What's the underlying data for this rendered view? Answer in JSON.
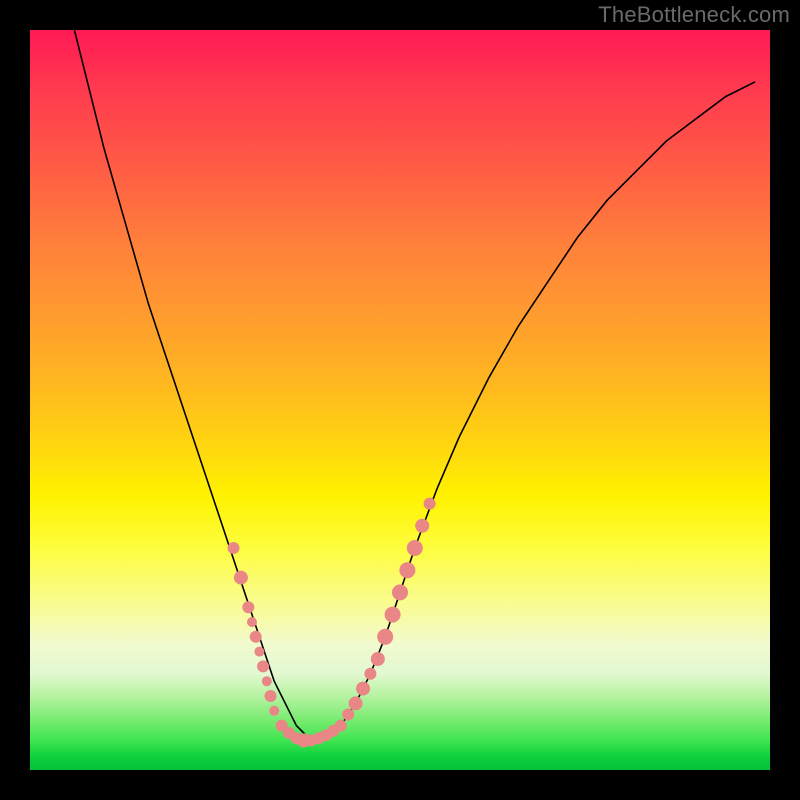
{
  "watermark": "TheBottleneck.com",
  "colors": {
    "dot": "#e98686",
    "curve": "#000000",
    "frame": "#000000"
  },
  "chart_data": {
    "type": "line",
    "title": "",
    "xlabel": "",
    "ylabel": "",
    "xlim": [
      0,
      100
    ],
    "ylim": [
      0,
      100
    ],
    "legend": false,
    "grid": false,
    "series": [
      {
        "name": "curve",
        "x": [
          6,
          8,
          10,
          12,
          14,
          16,
          18,
          20,
          22,
          24,
          26,
          28,
          30,
          31,
          32,
          33,
          34,
          35,
          36,
          37,
          38,
          40,
          42,
          44,
          46,
          48,
          50,
          52,
          55,
          58,
          62,
          66,
          70,
          74,
          78,
          82,
          86,
          90,
          94,
          98
        ],
        "y": [
          100,
          92,
          84,
          77,
          70,
          63,
          57,
          51,
          45,
          39,
          33,
          27,
          21,
          18,
          15,
          12,
          10,
          8,
          6,
          5,
          4,
          4.5,
          6,
          9,
          13,
          18,
          24,
          30,
          38,
          45,
          53,
          60,
          66,
          72,
          77,
          81,
          85,
          88,
          91,
          93
        ]
      }
    ],
    "points": [
      {
        "name": "left-cluster",
        "x": 27.5,
        "y": 30,
        "r": 6
      },
      {
        "name": "left-cluster",
        "x": 28.5,
        "y": 26,
        "r": 7
      },
      {
        "name": "left-cluster",
        "x": 29.5,
        "y": 22,
        "r": 6
      },
      {
        "name": "left-cluster",
        "x": 30.0,
        "y": 20,
        "r": 5
      },
      {
        "name": "left-cluster",
        "x": 30.5,
        "y": 18,
        "r": 6
      },
      {
        "name": "left-cluster",
        "x": 31.0,
        "y": 16,
        "r": 5
      },
      {
        "name": "left-cluster",
        "x": 31.5,
        "y": 14,
        "r": 6
      },
      {
        "name": "left-cluster",
        "x": 32.0,
        "y": 12,
        "r": 5
      },
      {
        "name": "left-cluster",
        "x": 32.5,
        "y": 10,
        "r": 6
      },
      {
        "name": "left-cluster",
        "x": 33.0,
        "y": 8,
        "r": 5
      },
      {
        "name": "bottom-cluster",
        "x": 34.0,
        "y": 6,
        "r": 6
      },
      {
        "name": "bottom-cluster",
        "x": 35.0,
        "y": 5,
        "r": 6
      },
      {
        "name": "bottom-cluster",
        "x": 36.0,
        "y": 4.3,
        "r": 6
      },
      {
        "name": "bottom-cluster",
        "x": 37.0,
        "y": 4,
        "r": 7
      },
      {
        "name": "bottom-cluster",
        "x": 38.0,
        "y": 4,
        "r": 6
      },
      {
        "name": "bottom-cluster",
        "x": 39.0,
        "y": 4.3,
        "r": 6
      },
      {
        "name": "bottom-cluster",
        "x": 40.0,
        "y": 4.7,
        "r": 6
      },
      {
        "name": "bottom-cluster",
        "x": 41.0,
        "y": 5.3,
        "r": 6
      },
      {
        "name": "bottom-cluster",
        "x": 42.0,
        "y": 6,
        "r": 6
      },
      {
        "name": "right-cluster",
        "x": 43.0,
        "y": 7.5,
        "r": 6
      },
      {
        "name": "right-cluster",
        "x": 44.0,
        "y": 9,
        "r": 7
      },
      {
        "name": "right-cluster",
        "x": 45.0,
        "y": 11,
        "r": 7
      },
      {
        "name": "right-cluster",
        "x": 46.0,
        "y": 13,
        "r": 6
      },
      {
        "name": "right-cluster",
        "x": 47.0,
        "y": 15,
        "r": 7
      },
      {
        "name": "right-cluster",
        "x": 48.0,
        "y": 18,
        "r": 8
      },
      {
        "name": "right-cluster",
        "x": 49.0,
        "y": 21,
        "r": 8
      },
      {
        "name": "right-cluster",
        "x": 50.0,
        "y": 24,
        "r": 8
      },
      {
        "name": "right-cluster",
        "x": 51.0,
        "y": 27,
        "r": 8
      },
      {
        "name": "right-cluster",
        "x": 52.0,
        "y": 30,
        "r": 8
      },
      {
        "name": "right-cluster",
        "x": 53.0,
        "y": 33,
        "r": 7
      },
      {
        "name": "right-cluster",
        "x": 54.0,
        "y": 36,
        "r": 6
      }
    ]
  }
}
